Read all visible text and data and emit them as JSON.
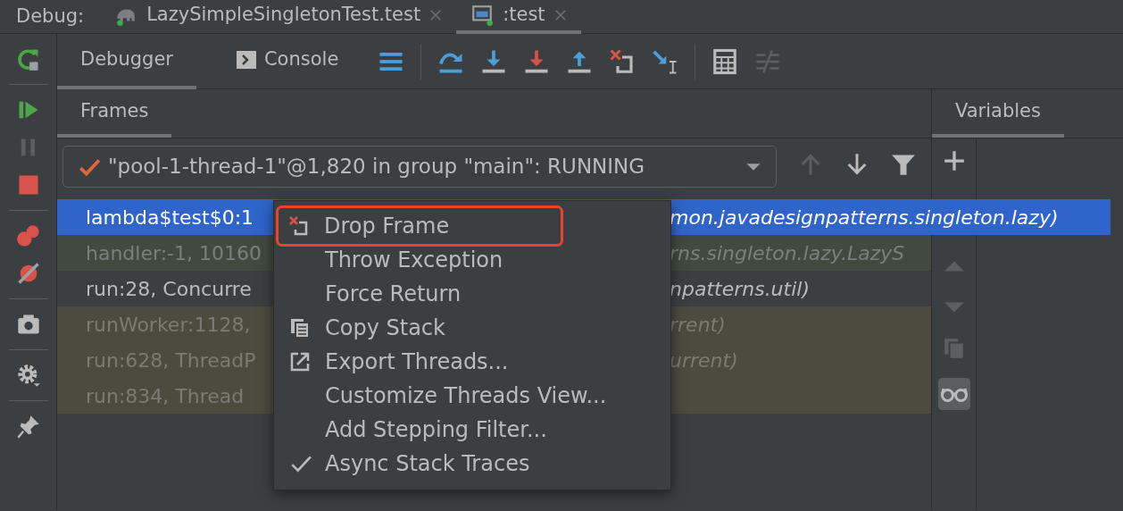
{
  "debug_label": "Debug:",
  "session_tabs": [
    {
      "label": "LazySimpleSingletonTest.test",
      "selected": false
    },
    {
      "label": ":test",
      "selected": true
    }
  ],
  "view_tabs": [
    {
      "label": "Debugger",
      "selected": true
    },
    {
      "label": "Console",
      "selected": false
    }
  ],
  "frames_panel": {
    "title": "Frames",
    "thread": "\"pool-1-thread-1\"@1,820 in group \"main\": RUNNING",
    "frames": [
      {
        "method": "lambda$test$0:1",
        "location": "mon.javadesignpatterns.singleton.lazy)",
        "kind": "normal",
        "selected": true
      },
      {
        "method": "handler:-1, 10160",
        "location": "rns.singleton.lazy.LazyS",
        "kind": "library",
        "selected": false
      },
      {
        "method": "run:28, Concurre",
        "location": "npatterns.util)",
        "kind": "normal",
        "selected": false
      },
      {
        "method": "runWorker:1128,",
        "location": "rrent)",
        "kind": "async",
        "selected": false
      },
      {
        "method": "run:628, ThreadP",
        "location": "urrent)",
        "kind": "async",
        "selected": false
      },
      {
        "method": "run:834, Thread",
        "kind": "async",
        "selected": false
      }
    ]
  },
  "variables_panel": {
    "title": "Variables"
  },
  "context_menu": {
    "items": [
      {
        "label": "Drop Frame",
        "kind": "drop",
        "checked": false,
        "highlighted": true
      },
      {
        "label": "Throw Exception",
        "kind": "plain",
        "checked": false,
        "highlighted": false
      },
      {
        "label": "Force Return",
        "kind": "plain",
        "checked": false,
        "highlighted": false
      },
      {
        "label": "Copy Stack",
        "kind": "copy",
        "checked": false,
        "highlighted": false
      },
      {
        "label": "Export Threads...",
        "kind": "export",
        "checked": false,
        "highlighted": false
      },
      {
        "label": "Customize Threads View...",
        "kind": "plain",
        "checked": false,
        "highlighted": false
      },
      {
        "label": "Add Stepping Filter...",
        "kind": "plain",
        "checked": false,
        "highlighted": false
      },
      {
        "label": "Async Stack Traces",
        "kind": "plain",
        "checked": true,
        "highlighted": false
      }
    ]
  }
}
